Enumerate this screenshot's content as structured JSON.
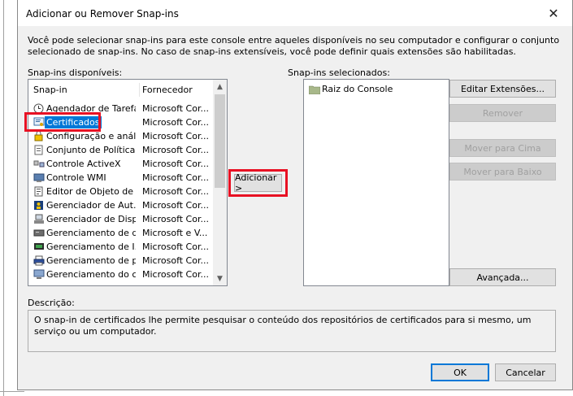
{
  "dialog": {
    "title": "Adicionar ou Remover Snap-ins",
    "close_glyph": "✕",
    "intro": "Você pode selecionar snap-ins para este console entre aqueles disponíveis no seu computador e configurar o conjunto selecionado de snap-ins. No caso de snap-ins extensíveis, você pode definir quais extensões são habilitadas."
  },
  "available": {
    "label": "Snap-ins disponíveis:",
    "col_snapin": "Snap-in",
    "col_vendor": "Fornecedor",
    "items": [
      {
        "name": "Agendador de Tarefas",
        "vendor": "Microsoft Cor...",
        "icon": "clock-icon"
      },
      {
        "name": "Certificados",
        "vendor": "Microsoft Cor...",
        "icon": "certificate-icon"
      },
      {
        "name": "Configuração e análi...",
        "vendor": "Microsoft Cor...",
        "icon": "security-config-icon"
      },
      {
        "name": "Conjunto de Política...",
        "vendor": "Microsoft Cor...",
        "icon": "policy-icon"
      },
      {
        "name": "Controle ActiveX",
        "vendor": "Microsoft Cor...",
        "icon": "activex-icon"
      },
      {
        "name": "Controle WMI",
        "vendor": "Microsoft Cor...",
        "icon": "wmi-icon"
      },
      {
        "name": "Editor de Objeto de ...",
        "vendor": "Microsoft Cor...",
        "icon": "gpo-editor-icon"
      },
      {
        "name": "Gerenciador de Aut...",
        "vendor": "Microsoft Cor...",
        "icon": "authorization-icon"
      },
      {
        "name": "Gerenciador de Disp...",
        "vendor": "Microsoft Cor...",
        "icon": "device-manager-icon"
      },
      {
        "name": "Gerenciamento de di...",
        "vendor": "Microsoft e V...",
        "icon": "disk-management-icon"
      },
      {
        "name": "Gerenciamento de I...",
        "vendor": "Microsoft Cor...",
        "icon": "ip-security-icon"
      },
      {
        "name": "Gerenciamento de p...",
        "vendor": "Microsoft Cor...",
        "icon": "print-management-icon"
      },
      {
        "name": "Gerenciamento do c...",
        "vendor": "Microsoft Cor...",
        "icon": "computer-management-icon"
      }
    ]
  },
  "selected": {
    "label": "Snap-ins selecionados:",
    "root": "Raiz do Console"
  },
  "buttons": {
    "add": "Adicionar >",
    "edit_extensions": "Editar Extensões...",
    "remove": "Remover",
    "move_up": "Mover para Cima",
    "move_down": "Mover para Baixo",
    "advanced": "Avançada...",
    "ok": "OK",
    "cancel": "Cancelar"
  },
  "description": {
    "label": "Descrição:",
    "text": "O snap-in de certificados lhe permite pesquisar o conteúdo dos repositórios de certificados para si mesmo, um serviço ou um computador."
  },
  "colors": {
    "selection": "#0078d7",
    "highlight_frame": "#e81123"
  }
}
